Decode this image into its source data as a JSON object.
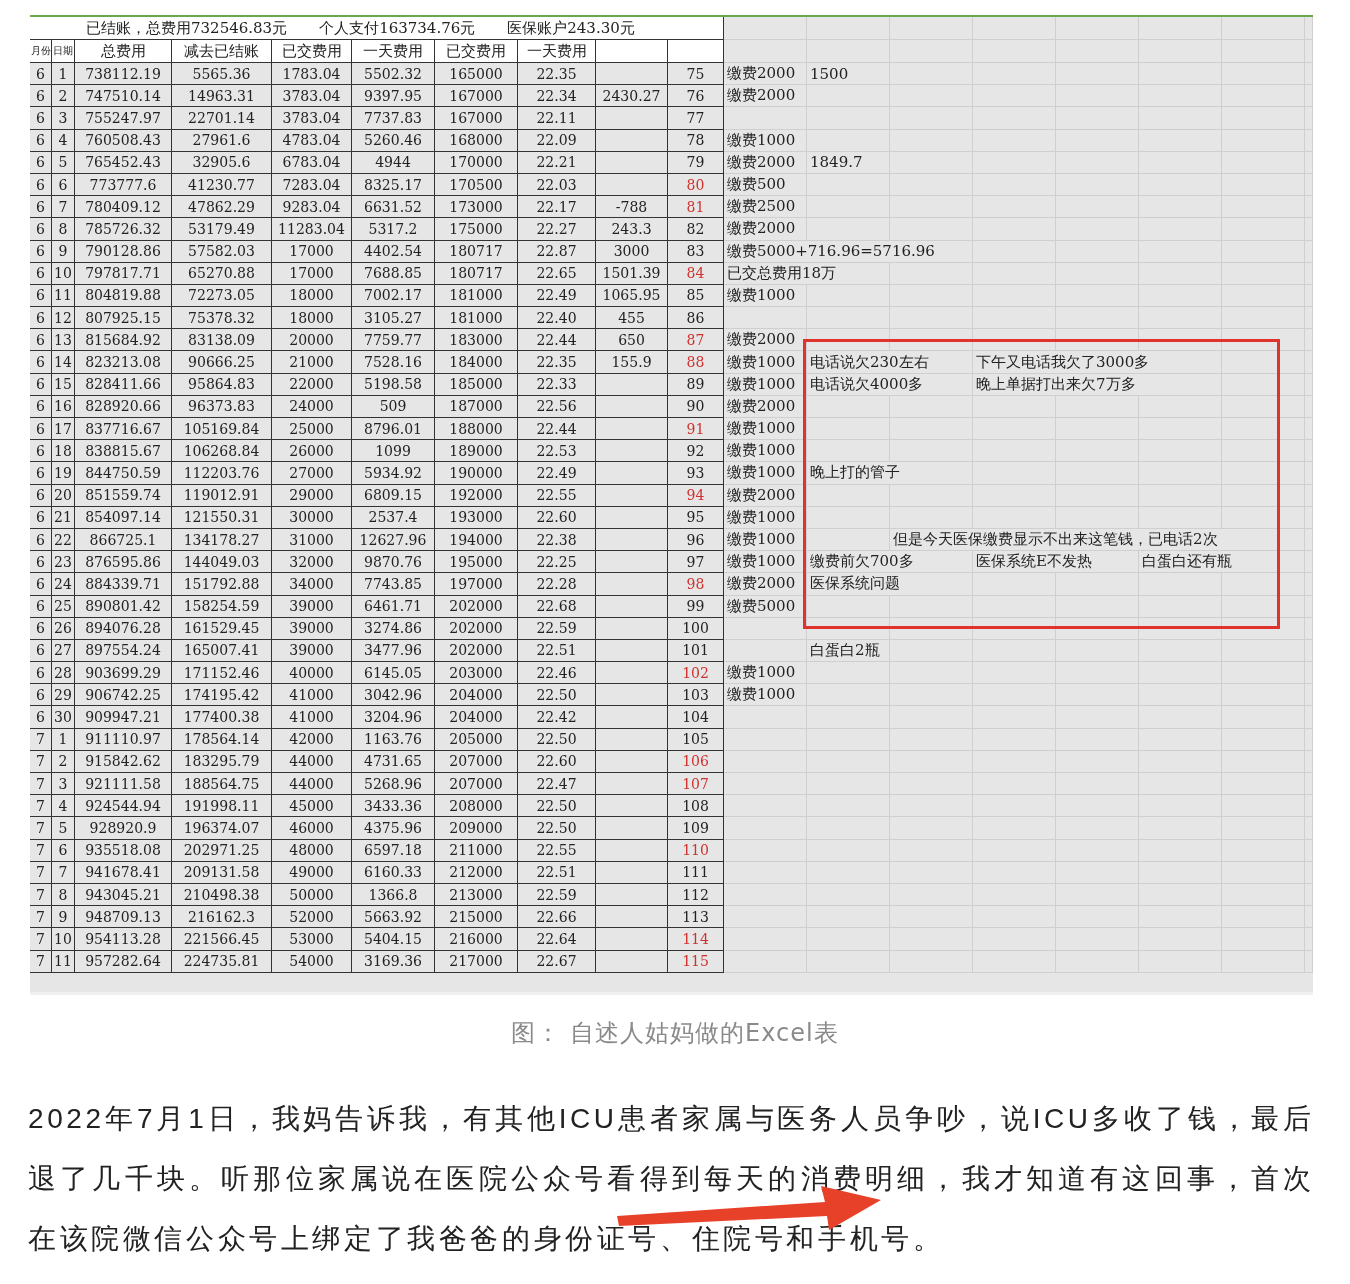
{
  "sheet": {
    "summary": [
      "已结账，总费用732546.83元",
      "个人支付163734.76元",
      "医保账户243.30元"
    ],
    "columns": [
      "月份",
      "日期",
      "总费用",
      "减去已结账",
      "已交费用",
      "一天费用",
      "已交费用",
      "一天费用"
    ],
    "rows": [
      {
        "month": "6",
        "day": "1",
        "total": "738112.19",
        "net": "5565.36",
        "paid": "1783.04",
        "daily": "5502.32",
        "paid_2": "165000",
        "daily_2": "22.35",
        "column_10": "75",
        "flagged": false,
        "column_11": "缴费2000",
        "column_12": "1500"
      },
      {
        "month": "6",
        "day": "2",
        "total": "747510.14",
        "net": "14963.31",
        "paid": "3783.04",
        "daily": "9397.95",
        "paid_2": "167000",
        "daily_2": "22.34",
        "column_9": "2430.27",
        "column_10": "76",
        "flagged": false,
        "column_11": "缴费2000"
      },
      {
        "month": "6",
        "day": "3",
        "total": "755247.97",
        "net": "22701.14",
        "paid": "3783.04",
        "daily": "7737.83",
        "paid_2": "167000",
        "daily_2": "22.11",
        "column_10": "77",
        "flagged": false
      },
      {
        "month": "6",
        "day": "4",
        "total": "760508.43",
        "net": "27961.6",
        "paid": "4783.04",
        "daily": "5260.46",
        "paid_2": "168000",
        "daily_2": "22.09",
        "column_10": "78",
        "flagged": false,
        "column_11": "缴费1000"
      },
      {
        "month": "6",
        "day": "5",
        "total": "765452.43",
        "net": "32905.6",
        "paid": "6783.04",
        "daily": "4944",
        "paid_2": "170000",
        "daily_2": "22.21",
        "column_10": "79",
        "flagged": false,
        "column_11": "缴费2000",
        "column_12": "1849.7"
      },
      {
        "month": "6",
        "day": "6",
        "total": "773777.6",
        "net": "41230.77",
        "paid": "7283.04",
        "daily": "8325.17",
        "paid_2": "170500",
        "daily_2": "22.03",
        "column_10": "80",
        "flagged": true,
        "column_11": "缴费500"
      },
      {
        "month": "6",
        "day": "7",
        "total": "780409.12",
        "net": "47862.29",
        "paid": "9283.04",
        "daily": "6631.52",
        "paid_2": "173000",
        "daily_2": "22.17",
        "column_9": "-788",
        "column_10": "81",
        "flagged": true,
        "column_11": "缴费2500"
      },
      {
        "month": "6",
        "day": "8",
        "total": "785726.32",
        "net": "53179.49",
        "paid": "11283.04",
        "daily": "5317.2",
        "paid_2": "175000",
        "daily_2": "22.27",
        "column_9": "243.3",
        "column_10": "82",
        "flagged": false,
        "column_11": "缴费2000"
      },
      {
        "month": "6",
        "day": "9",
        "total": "790128.86",
        "net": "57582.03",
        "paid": "17000",
        "daily": "4402.54",
        "paid_2": "180717",
        "daily_2": "22.87",
        "column_9": "3000",
        "column_10": "83",
        "flagged": false,
        "column_11": "缴费5000+716.96=5716.96"
      },
      {
        "month": "6",
        "day": "10",
        "total": "797817.71",
        "net": "65270.88",
        "paid": "17000",
        "daily": "7688.85",
        "paid_2": "180717",
        "daily_2": "22.65",
        "column_9": "1501.39",
        "column_10": "84",
        "flagged": true,
        "column_11": "已交总费用18万"
      },
      {
        "month": "6",
        "day": "11",
        "total": "804819.88",
        "net": "72273.05",
        "paid": "18000",
        "daily": "7002.17",
        "paid_2": "181000",
        "daily_2": "22.49",
        "column_9": "1065.95",
        "column_10": "85",
        "flagged": false,
        "column_11": "缴费1000"
      },
      {
        "month": "6",
        "day": "12",
        "total": "807925.15",
        "net": "75378.32",
        "paid": "18000",
        "daily": "3105.27",
        "paid_2": "181000",
        "daily_2": "22.40",
        "column_9": "455",
        "column_10": "86",
        "flagged": false
      },
      {
        "month": "6",
        "day": "13",
        "total": "815684.92",
        "net": "83138.09",
        "paid": "20000",
        "daily": "7759.77",
        "paid_2": "183000",
        "daily_2": "22.44",
        "column_9": "650",
        "column_10": "87",
        "flagged": true,
        "column_11": "缴费2000"
      },
      {
        "month": "6",
        "day": "14",
        "total": "823213.08",
        "net": "90666.25",
        "paid": "21000",
        "daily": "7528.16",
        "paid_2": "184000",
        "daily_2": "22.35",
        "column_9": "155.9",
        "column_10": "88",
        "flagged": true,
        "column_11": "缴费1000",
        "column_12": "电话说欠230左右",
        "column_14": "下午又电话我欠了3000多"
      },
      {
        "month": "6",
        "day": "15",
        "total": "828411.66",
        "net": "95864.83",
        "paid": "22000",
        "daily": "5198.58",
        "paid_2": "185000",
        "daily_2": "22.33",
        "column_10": "89",
        "flagged": false,
        "column_11": "缴费1000",
        "column_12": "电话说欠4000多",
        "column_14": "晚上单据打出来欠7万多"
      },
      {
        "month": "6",
        "day": "16",
        "total": "828920.66",
        "net": "96373.83",
        "paid": "24000",
        "daily": "509",
        "paid_2": "187000",
        "daily_2": "22.56",
        "column_10": "90",
        "flagged": false,
        "column_11": "缴费2000"
      },
      {
        "month": "6",
        "day": "17",
        "total": "837716.67",
        "net": "105169.84",
        "paid": "25000",
        "daily": "8796.01",
        "paid_2": "188000",
        "daily_2": "22.44",
        "column_10": "91",
        "flagged": true,
        "column_11": "缴费1000"
      },
      {
        "month": "6",
        "day": "18",
        "total": "838815.67",
        "net": "106268.84",
        "paid": "26000",
        "daily": "1099",
        "paid_2": "189000",
        "daily_2": "22.53",
        "column_10": "92",
        "flagged": false,
        "column_11": "缴费1000"
      },
      {
        "month": "6",
        "day": "19",
        "total": "844750.59",
        "net": "112203.76",
        "paid": "27000",
        "daily": "5934.92",
        "paid_2": "190000",
        "daily_2": "22.49",
        "column_10": "93",
        "flagged": false,
        "column_11": "缴费1000",
        "column_12": "晚上打的管子"
      },
      {
        "month": "6",
        "day": "20",
        "total": "851559.74",
        "net": "119012.91",
        "paid": "29000",
        "daily": "6809.15",
        "paid_2": "192000",
        "daily_2": "22.55",
        "column_10": "94",
        "flagged": true,
        "column_11": "缴费2000"
      },
      {
        "month": "6",
        "day": "21",
        "total": "854097.14",
        "net": "121550.31",
        "paid": "30000",
        "daily": "2537.4",
        "paid_2": "193000",
        "daily_2": "22.60",
        "column_10": "95",
        "flagged": false,
        "column_11": "缴费1000"
      },
      {
        "month": "6",
        "day": "22",
        "total": "866725.1",
        "net": "134178.27",
        "paid": "31000",
        "daily": "12627.96",
        "paid_2": "194000",
        "daily_2": "22.38",
        "column_10": "96",
        "flagged": false,
        "column_11": "缴费1000",
        "column_13": "但是今天医保缴费显示不出来这笔钱，已电话2次"
      },
      {
        "month": "6",
        "day": "23",
        "total": "876595.86",
        "net": "144049.03",
        "paid": "32000",
        "daily": "9870.76",
        "paid_2": "195000",
        "daily_2": "22.25",
        "column_10": "97",
        "flagged": false,
        "column_11": "缴费1000",
        "column_12": "缴费前欠700多",
        "column_14": "医保系统E不发热",
        "column_16": "白蛋白还有瓶"
      },
      {
        "month": "6",
        "day": "24",
        "total": "884339.71",
        "net": "151792.88",
        "paid": "34000",
        "daily": "7743.85",
        "paid_2": "197000",
        "daily_2": "22.28",
        "column_10": "98",
        "flagged": true,
        "column_11": "缴费2000",
        "column_12": "医保系统问题"
      },
      {
        "month": "6",
        "day": "25",
        "total": "890801.42",
        "net": "158254.59",
        "paid": "39000",
        "daily": "6461.71",
        "paid_2": "202000",
        "daily_2": "22.68",
        "column_10": "99",
        "flagged": false,
        "column_11": "缴费5000"
      },
      {
        "month": "6",
        "day": "26",
        "total": "894076.28",
        "net": "161529.45",
        "paid": "39000",
        "daily": "3274.86",
        "paid_2": "202000",
        "daily_2": "22.59",
        "column_10": "100",
        "flagged": false
      },
      {
        "month": "6",
        "day": "27",
        "total": "897554.24",
        "net": "165007.41",
        "paid": "39000",
        "daily": "3477.96",
        "paid_2": "202000",
        "daily_2": "22.51",
        "column_10": "101",
        "flagged": false,
        "column_12": "白蛋白2瓶"
      },
      {
        "month": "6",
        "day": "28",
        "total": "903699.29",
        "net": "171152.46",
        "paid": "40000",
        "daily": "6145.05",
        "paid_2": "203000",
        "daily_2": "22.46",
        "column_10": "102",
        "flagged": true,
        "column_11": "缴费1000"
      },
      {
        "month": "6",
        "day": "29",
        "total": "906742.25",
        "net": "174195.42",
        "paid": "41000",
        "daily": "3042.96",
        "paid_2": "204000",
        "daily_2": "22.50",
        "column_10": "103",
        "flagged": false,
        "column_11": "缴费1000"
      },
      {
        "month": "6",
        "day": "30",
        "total": "909947.21",
        "net": "177400.38",
        "paid": "41000",
        "daily": "3204.96",
        "paid_2": "204000",
        "daily_2": "22.42",
        "column_10": "104",
        "flagged": false
      },
      {
        "month": "7",
        "day": "1",
        "total": "911110.97",
        "net": "178564.14",
        "paid": "42000",
        "daily": "1163.76",
        "paid_2": "205000",
        "daily_2": "22.50",
        "column_10": "105",
        "flagged": false
      },
      {
        "month": "7",
        "day": "2",
        "total": "915842.62",
        "net": "183295.79",
        "paid": "44000",
        "daily": "4731.65",
        "paid_2": "207000",
        "daily_2": "22.60",
        "column_10": "106",
        "flagged": true
      },
      {
        "month": "7",
        "day": "3",
        "total": "921111.58",
        "net": "188564.75",
        "paid": "44000",
        "daily": "5268.96",
        "paid_2": "207000",
        "daily_2": "22.47",
        "column_10": "107",
        "flagged": true
      },
      {
        "month": "7",
        "day": "4",
        "total": "924544.94",
        "net": "191998.11",
        "paid": "45000",
        "daily": "3433.36",
        "paid_2": "208000",
        "daily_2": "22.50",
        "column_10": "108",
        "flagged": false
      },
      {
        "month": "7",
        "day": "5",
        "total": "928920.9",
        "net": "196374.07",
        "paid": "46000",
        "daily": "4375.96",
        "paid_2": "209000",
        "daily_2": "22.50",
        "column_10": "109",
        "flagged": false
      },
      {
        "month": "7",
        "day": "6",
        "total": "935518.08",
        "net": "202971.25",
        "paid": "48000",
        "daily": "6597.18",
        "paid_2": "211000",
        "daily_2": "22.55",
        "column_10": "110",
        "flagged": true
      },
      {
        "month": "7",
        "day": "7",
        "total": "941678.41",
        "net": "209131.58",
        "paid": "49000",
        "daily": "6160.33",
        "paid_2": "212000",
        "daily_2": "22.51",
        "column_10": "111",
        "flagged": false
      },
      {
        "month": "7",
        "day": "8",
        "total": "943045.21",
        "net": "210498.38",
        "paid": "50000",
        "daily": "1366.8",
        "paid_2": "213000",
        "daily_2": "22.59",
        "column_10": "112",
        "flagged": false
      },
      {
        "month": "7",
        "day": "9",
        "total": "948709.13",
        "net": "216162.3",
        "paid": "52000",
        "daily": "5663.92",
        "paid_2": "215000",
        "daily_2": "22.66",
        "column_10": "113",
        "flagged": false
      },
      {
        "month": "7",
        "day": "10",
        "total": "954113.28",
        "net": "221566.45",
        "paid": "53000",
        "daily": "5404.15",
        "paid_2": "216000",
        "daily_2": "22.64",
        "column_10": "114",
        "flagged": true
      },
      {
        "month": "7",
        "day": "11",
        "total": "957282.64",
        "net": "224735.81",
        "paid": "54000",
        "daily": "3169.36",
        "paid_2": "217000",
        "daily_2": "22.67",
        "column_10": "115",
        "flagged": true
      }
    ]
  },
  "caption": "图： 自述人姑妈做的Excel表",
  "paragraph": "2022年7月1日，我妈告诉我，有其他ICU患者家属与医务人员争吵，说ICU多收了钱，最后退了几千块。听那位家属说在医院公众号看得到每天的消费明细，我才知道有这回事，首次在该院微信公众号上绑定了我爸爸的身份证号、住院号和手机号。",
  "red_frame": true,
  "arrow": true
}
